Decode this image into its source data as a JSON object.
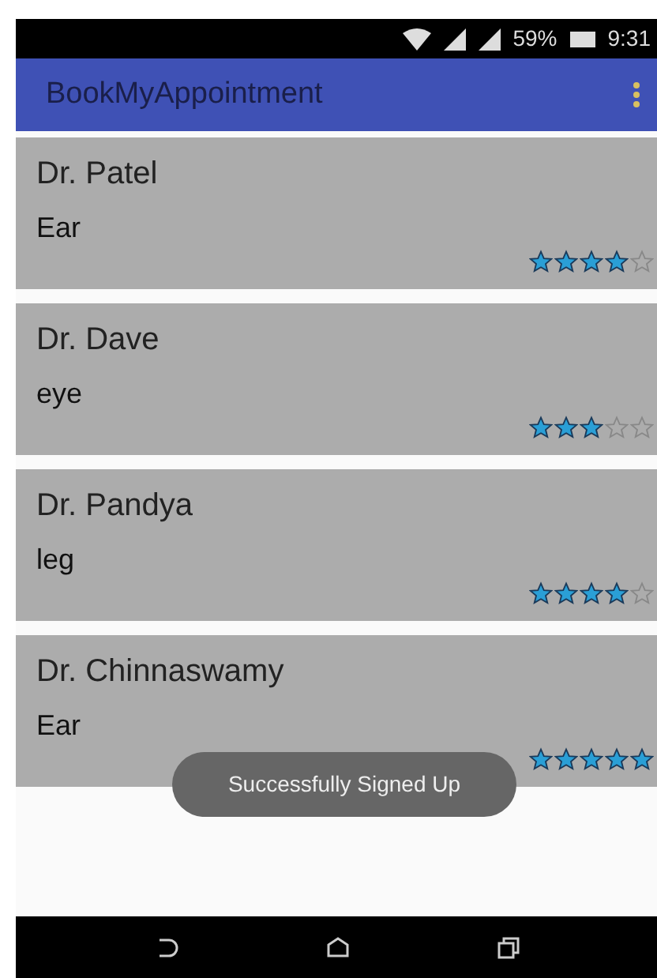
{
  "status_bar": {
    "battery": "59%",
    "time": "9:31"
  },
  "app_bar": {
    "title": "BookMyAppointment"
  },
  "doctors": [
    {
      "name": "Dr. Patel",
      "specialty": "Ear",
      "stars": 4
    },
    {
      "name": "Dr. Dave",
      "specialty": "eye",
      "stars": 3
    },
    {
      "name": "Dr. Pandya",
      "specialty": "leg",
      "stars": 4
    },
    {
      "name": "Dr. Chinnaswamy",
      "specialty": "Ear",
      "stars": 5
    }
  ],
  "toast": "Successfully Signed Up"
}
